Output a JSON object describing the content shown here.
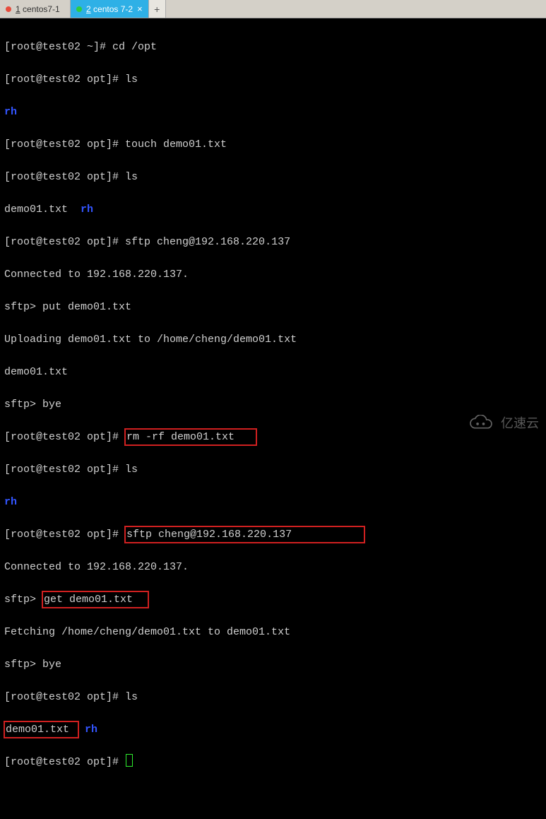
{
  "tabs": {
    "items": [
      {
        "num": "1",
        "label": "centos7-1",
        "active": false
      },
      {
        "num": "2",
        "label": "centos 7-2",
        "active": true
      }
    ],
    "add": "+"
  },
  "term": {
    "l1_prompt": "[root@test02 ~]# ",
    "l1_cmd": "cd /opt",
    "l2_prompt": "[root@test02 opt]# ",
    "l2_cmd": "ls",
    "l3_rh": "rh",
    "l4_prompt": "[root@test02 opt]# ",
    "l4_cmd": "touch demo01.txt",
    "l5_prompt": "[root@test02 opt]# ",
    "l5_cmd": "ls",
    "l6_file": "demo01.txt",
    "l6_rh": "rh",
    "l7_prompt": "[root@test02 opt]# ",
    "l7_cmd": "sftp cheng@192.168.220.137",
    "l8": "Connected to 192.168.220.137.",
    "l9_prompt": "sftp> ",
    "l9_cmd": "put demo01.txt",
    "l10": "Uploading demo01.txt to /home/cheng/demo01.txt",
    "l11": "demo01.txt",
    "l12_prompt": "sftp> ",
    "l12_cmd": "bye",
    "l13_prompt": "[root@test02 opt]# ",
    "l13_cmd": "rm -rf demo01.txt",
    "l14_prompt": "[root@test02 opt]# ",
    "l14_cmd": "ls",
    "l15_rh": "rh",
    "l16_prompt": "[root@test02 opt]# ",
    "l16_cmd": "sftp cheng@192.168.220.137",
    "l17": "Connected to 192.168.220.137.",
    "l18_prompt": "sftp> ",
    "l18_cmd": "get demo01.txt",
    "l19": "Fetching /home/cheng/demo01.txt to demo01.txt",
    "l20_prompt": "sftp> ",
    "l20_cmd": "bye",
    "l21_prompt": "[root@test02 opt]# ",
    "l21_cmd": "ls",
    "l22_file": "demo01.txt ",
    "l22_rh": "rh",
    "l23_prompt": "[root@test02 opt]# "
  },
  "watermark": {
    "text": "亿速云"
  }
}
